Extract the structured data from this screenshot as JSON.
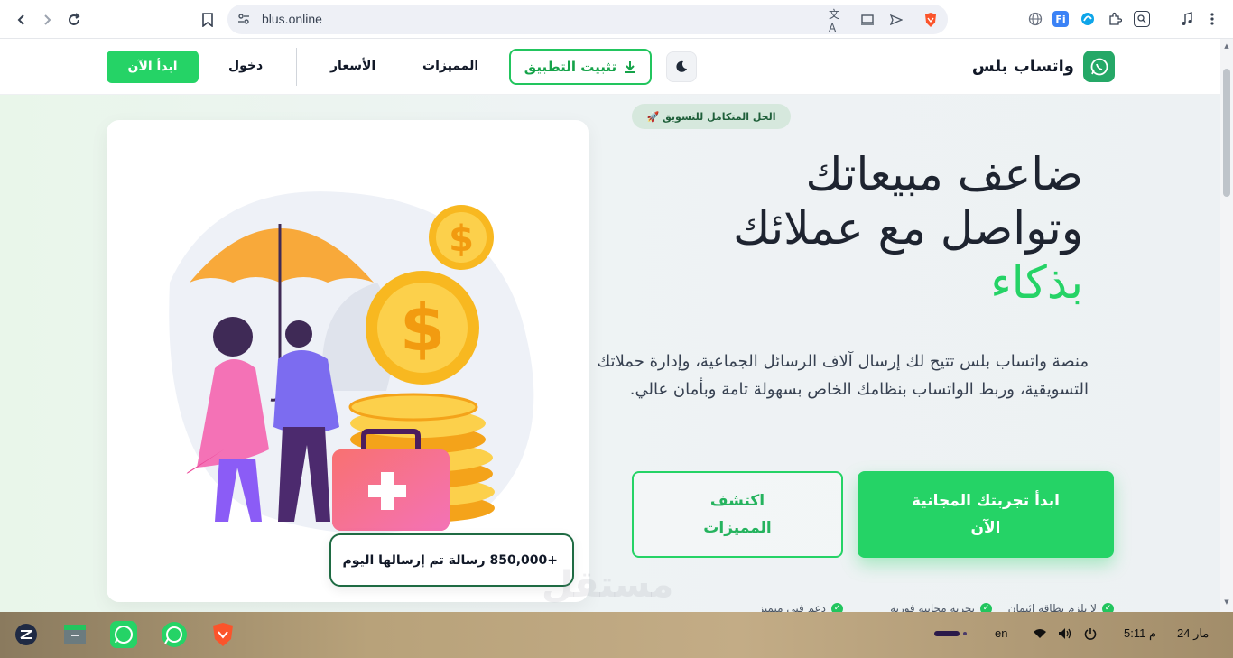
{
  "browser": {
    "url": "blus.online"
  },
  "header": {
    "logo_text": "واتساب بلس",
    "install_label": "تثبيت التطبيق",
    "nav": {
      "features": "المميزات",
      "pricing": "الأسعار",
      "login": "دخول"
    },
    "start_label": "ابدأ الآن"
  },
  "hero": {
    "badge": "🚀 الحل المتكامل للتسويق",
    "headline_line1": "ضاعف مبيعاتك",
    "headline_line2": "وتواصل مع عملائك",
    "headline_line3": "بذكاء",
    "description": "منصة واتساب بلس تتيح لك إرسال آلاف الرسائل الجماعية، وإدارة حملاتك التسويقية، وربط الواتساب بنظامك الخاص بسهولة تامة وبأمان عالي.",
    "cta_primary_line1": "ابدأ تجربتك المجانية",
    "cta_primary_line2": "الآن",
    "cta_secondary_line1": "اكتشف",
    "cta_secondary_line2": "المميزات",
    "features": [
      "لا يلزم بطاقة ائتمان",
      "تجربة مجانية فورية",
      "دعم فني متميز"
    ],
    "stat": "+850,000 رسالة تم إرسالها اليوم",
    "watermark": "مستقل"
  },
  "taskbar": {
    "lang": "en",
    "time": "5:11 م",
    "date": "24 مار"
  },
  "colors": {
    "accent": "#25d366",
    "dark_green": "#1f6b43",
    "text": "#1e2430"
  }
}
